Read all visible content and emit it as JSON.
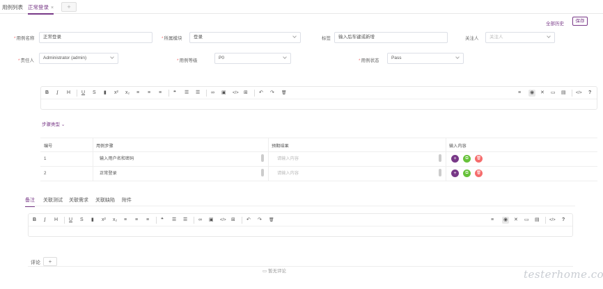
{
  "tabs": {
    "items": [
      {
        "label": "用例列表",
        "active": false
      },
      {
        "label": "正常登录",
        "active": true
      }
    ],
    "add_label": "+",
    "close_glyph": "×"
  },
  "header": {
    "history_link": "全部历史",
    "save_label": "保存"
  },
  "form": {
    "name": {
      "label": "用例名称",
      "value": "正常登录"
    },
    "module": {
      "label": "所属模块",
      "value": "登录"
    },
    "tags": {
      "label": "标签",
      "value": "输入后车键或新增"
    },
    "follower": {
      "label": "关注人",
      "placeholder": "关注人"
    },
    "maintainer": {
      "label": "责任人",
      "value": "Administrator (admin)"
    },
    "priority": {
      "label": "用例等级",
      "value": "P0"
    },
    "status": {
      "label": "用例状态",
      "value": "Pass"
    }
  },
  "toolbar_icons": {
    "left": [
      "bold-icon",
      "italic-icon",
      "heading-icon",
      "underline-icon",
      "strike-icon",
      "bookmark-icon",
      "superscript-icon",
      "subscript-icon",
      "align-left-icon",
      "align-center-icon",
      "align-right-icon",
      "quote-icon",
      "ordered-list-icon",
      "unordered-list-icon",
      "link-icon",
      "image-icon",
      "code-icon",
      "table-icon",
      "undo-icon",
      "redo-icon",
      "trash-icon"
    ],
    "right": [
      "list-icon",
      "preview-icon",
      "fullscreen-icon",
      "window-icon",
      "column-icon",
      "source-code-icon",
      "help-icon"
    ]
  },
  "toolbar_glyphs": {
    "bold": "B",
    "italic": "I",
    "heading": "H",
    "underline": "U",
    "strike": "S",
    "bookmark": "▮",
    "superscript": "x²",
    "subscript": "x₂",
    "align_left": "≡",
    "align_center": "≡",
    "align_right": "≡",
    "quote": "❝",
    "ol": "☰",
    "ul": "☰",
    "link": "∞",
    "image": "▣",
    "code": "</>",
    "table": "⊞",
    "undo": "↶",
    "redo": "↷",
    "trash": "🗑",
    "list": "≡",
    "preview": "◉",
    "fullscreen": "✕",
    "window": "▭",
    "column": "▤",
    "source": "</>",
    "help": "?"
  },
  "step_type": {
    "label": "步骤类型"
  },
  "steps_table": {
    "headers": [
      "编号",
      "用例步骤",
      "预期结果",
      "输入内容"
    ],
    "rows": [
      {
        "no": "1",
        "step": "输入用户名和密码",
        "expected_placeholder": "请输入内容"
      },
      {
        "no": "2",
        "step": "正常登录",
        "expected_placeholder": "请输入内容"
      }
    ],
    "action_glyphs": {
      "add": "+",
      "copy": "⧉",
      "delete": "🗑"
    }
  },
  "sub_tabs": [
    "备注",
    "关联测试",
    "关联需求",
    "关联缺陷",
    "附件"
  ],
  "comments": {
    "label": "评论",
    "add": "+",
    "empty_text": "暂无评论",
    "empty_icon": "comment-icon"
  },
  "watermark": "testerhome.com",
  "colors": {
    "accent": "#783887",
    "success": "#67c23a",
    "danger": "#f56c6c"
  }
}
